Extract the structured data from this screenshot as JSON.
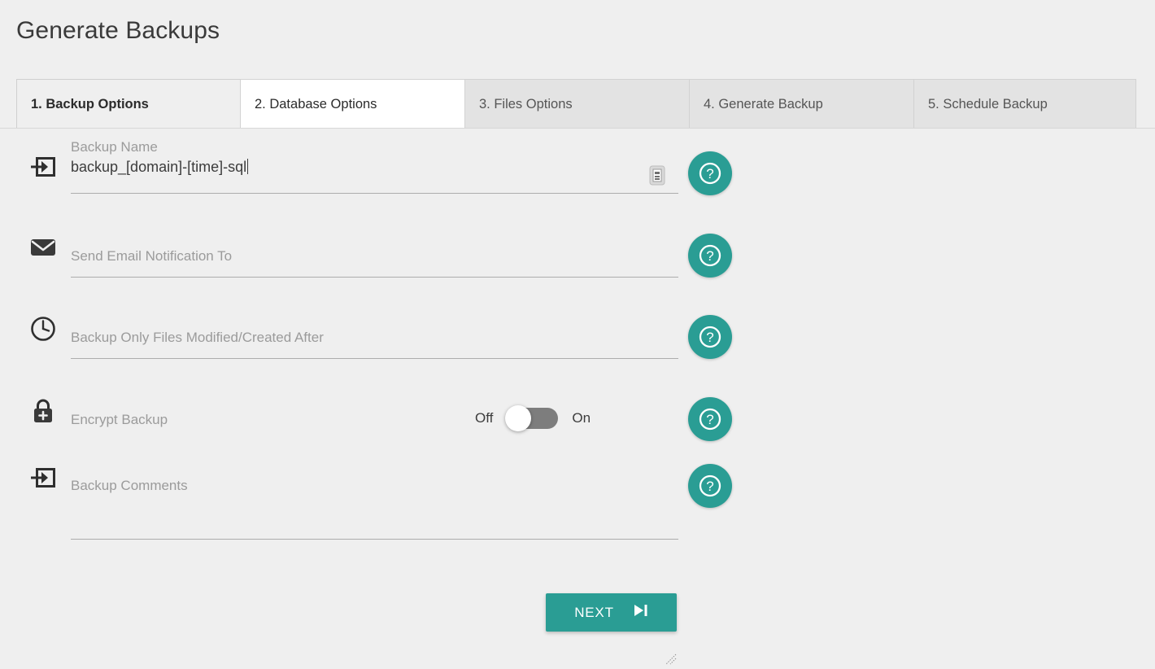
{
  "page": {
    "title": "Generate Backups",
    "background_color": "#efefef",
    "accent_color": "#2a9d94"
  },
  "tabs": [
    {
      "label": "1. Backup Options",
      "state": "current"
    },
    {
      "label": "2. Database Options",
      "state": "active"
    },
    {
      "label": "3. Files Options",
      "state": "inactive"
    },
    {
      "label": "4. Generate Backup",
      "state": "inactive"
    },
    {
      "label": "5. Schedule Backup",
      "state": "inactive"
    }
  ],
  "form": {
    "rows": [
      {
        "icon": "arrow-into-box-icon",
        "label": "Backup Name",
        "value": "backup_[domain]-[time]-sql",
        "placeholder": "Backup Name",
        "has_inline_icon": true,
        "inline_icon": "template-picker-icon",
        "help_label": "?"
      },
      {
        "icon": "envelope-icon",
        "label": "Send Email Notification To",
        "value": "",
        "placeholder": "Send Email Notification To",
        "has_inline_icon": false,
        "help_label": "?"
      },
      {
        "icon": "clock-icon",
        "label": "Backup Only Files Modified/Created After",
        "value": "",
        "placeholder": "Backup Only Files Modified/Created After",
        "has_inline_icon": false,
        "help_label": "?"
      },
      {
        "icon": "lock-plus-icon",
        "label": "Encrypt Backup",
        "value": "",
        "placeholder": "Encrypt Backup",
        "has_inline_icon": false,
        "help_label": "?"
      },
      {
        "icon": "arrow-into-box-icon",
        "label": "Backup Comments",
        "value": "",
        "placeholder": "Backup Comments",
        "has_inline_icon": false,
        "help_label": "?"
      }
    ],
    "encrypt_toggle": {
      "off_label": "Off",
      "on_label": "On",
      "state": "off"
    }
  },
  "footer": {
    "next_label": "NEXT",
    "next_icon": "skip-forward-icon"
  }
}
